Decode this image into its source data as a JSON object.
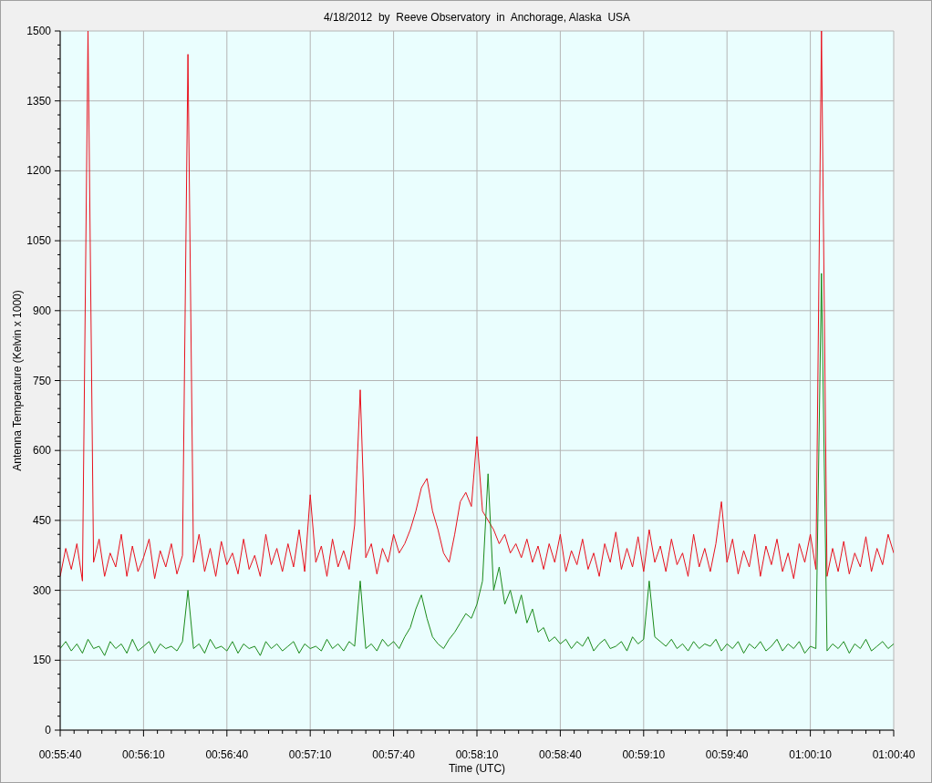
{
  "chart_data": {
    "type": "line",
    "title": "4/18/2012  by  Reeve Observatory  in  Anchorage, Alaska  USA",
    "xlabel": "Time (UTC)",
    "ylabel": "Antenna Temperature (Kelvin x 1000)",
    "categories": [
      "00:55:40",
      null,
      null,
      null,
      null,
      null,
      null,
      null,
      null,
      null,
      null,
      null,
      null,
      null,
      null,
      "00:56:10",
      null,
      null,
      null,
      null,
      null,
      null,
      null,
      null,
      null,
      null,
      null,
      null,
      null,
      null,
      "00:56:40",
      null,
      null,
      null,
      null,
      null,
      null,
      null,
      null,
      null,
      null,
      null,
      null,
      null,
      null,
      "00:57:10",
      null,
      null,
      null,
      null,
      null,
      null,
      null,
      null,
      null,
      null,
      null,
      null,
      null,
      null,
      "00:57:40",
      null,
      null,
      null,
      null,
      null,
      null,
      null,
      null,
      null,
      null,
      null,
      null,
      null,
      null,
      "00:58:10",
      null,
      null,
      null,
      null,
      null,
      null,
      null,
      null,
      null,
      null,
      null,
      null,
      null,
      null,
      "00:58:40",
      null,
      null,
      null,
      null,
      null,
      null,
      null,
      null,
      null,
      null,
      null,
      null,
      null,
      null,
      "00:59:10",
      null,
      null,
      null,
      null,
      null,
      null,
      null,
      null,
      null,
      null,
      null,
      null,
      null,
      null,
      "00:59:40",
      null,
      null,
      null,
      null,
      null,
      null,
      null,
      null,
      null,
      null,
      null,
      null,
      null,
      null,
      "01:00:10",
      null,
      null,
      null,
      null,
      null,
      null,
      null,
      null,
      null,
      null,
      null,
      null,
      null,
      null,
      "01:00:40"
    ],
    "series": [
      {
        "color": "#e8101c",
        "values": [
          330,
          390,
          345,
          400,
          320,
          1500,
          360,
          410,
          330,
          380,
          350,
          420,
          330,
          395,
          340,
          370,
          410,
          325,
          385,
          350,
          400,
          335,
          375,
          1450,
          360,
          420,
          340,
          390,
          330,
          405,
          355,
          380,
          335,
          410,
          345,
          375,
          330,
          420,
          355,
          390,
          340,
          400,
          350,
          430,
          340,
          505,
          360,
          395,
          330,
          410,
          350,
          385,
          345,
          440,
          730,
          370,
          400,
          335,
          390,
          360,
          420,
          380,
          400,
          430,
          470,
          520,
          540,
          470,
          430,
          380,
          360,
          420,
          490,
          510,
          480,
          630,
          470,
          450,
          430,
          400,
          420,
          380,
          400,
          370,
          410,
          360,
          395,
          345,
          400,
          360,
          420,
          340,
          385,
          355,
          410,
          345,
          380,
          330,
          400,
          360,
          425,
          345,
          390,
          350,
          415,
          340,
          430,
          360,
          395,
          340,
          410,
          355,
          380,
          330,
          420,
          350,
          390,
          340,
          400,
          490,
          360,
          410,
          335,
          385,
          350,
          420,
          330,
          395,
          355,
          410,
          340,
          380,
          325,
          400,
          360,
          420,
          345,
          1500,
          330,
          390,
          340,
          405,
          335,
          380,
          350,
          415,
          340,
          390,
          355,
          420,
          380
        ]
      },
      {
        "color": "#1a8a1a",
        "values": [
          175,
          190,
          170,
          185,
          165,
          195,
          175,
          180,
          160,
          190,
          175,
          185,
          165,
          195,
          170,
          180,
          190,
          165,
          185,
          175,
          180,
          170,
          190,
          300,
          175,
          185,
          165,
          195,
          175,
          180,
          170,
          190,
          165,
          185,
          175,
          180,
          160,
          190,
          175,
          185,
          170,
          180,
          190,
          165,
          185,
          175,
          180,
          170,
          195,
          175,
          185,
          170,
          190,
          180,
          320,
          175,
          185,
          170,
          195,
          180,
          190,
          175,
          200,
          220,
          260,
          290,
          240,
          200,
          185,
          175,
          195,
          210,
          230,
          250,
          240,
          270,
          320,
          550,
          300,
          350,
          270,
          300,
          250,
          290,
          230,
          260,
          210,
          220,
          190,
          200,
          185,
          195,
          175,
          190,
          180,
          200,
          170,
          185,
          195,
          175,
          180,
          190,
          170,
          200,
          185,
          195,
          320,
          200,
          190,
          180,
          195,
          175,
          185,
          170,
          190,
          175,
          185,
          180,
          195,
          170,
          185,
          175,
          190,
          165,
          185,
          175,
          190,
          170,
          180,
          195,
          170,
          185,
          175,
          190,
          165,
          180,
          175,
          980,
          170,
          185,
          175,
          190,
          165,
          185,
          175,
          195,
          170,
          180,
          190,
          175,
          185
        ]
      }
    ],
    "ylim": [
      0,
      1500
    ],
    "grid": true,
    "yticks": [
      0,
      150,
      300,
      450,
      600,
      750,
      900,
      1050,
      1200,
      1350,
      1500
    ]
  }
}
